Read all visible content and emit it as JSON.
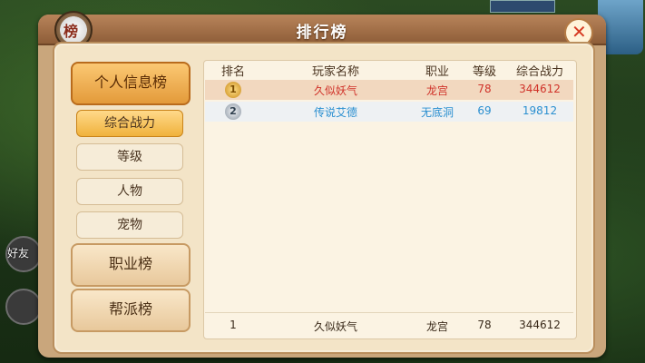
{
  "panel": {
    "title": "排行榜",
    "rank_icon_glyph": "榜",
    "close_glyph": "✕"
  },
  "hud": {
    "friends_label": "好友"
  },
  "nav": {
    "main": [
      {
        "label": "个人信息榜",
        "active": true
      },
      {
        "label": "职业榜",
        "active": false
      },
      {
        "label": "帮派榜",
        "active": false
      }
    ],
    "sub": [
      {
        "label": "综合战力",
        "active": true
      },
      {
        "label": "等级",
        "active": false
      },
      {
        "label": "人物",
        "active": false
      },
      {
        "label": "宠物",
        "active": false
      }
    ]
  },
  "table": {
    "headers": [
      "排名",
      "玩家名称",
      "职业",
      "等级",
      "综合战力"
    ],
    "rows": [
      {
        "rank": "1",
        "name": "久似妖气",
        "job": "龙宫",
        "level": "78",
        "power": "344612",
        "color": "#d0332a"
      },
      {
        "rank": "2",
        "name": "传说艾德",
        "job": "无底洞",
        "level": "69",
        "power": "19812",
        "color": "#2a8fd0"
      }
    ],
    "self_row": {
      "rank": "1",
      "name": "久似妖气",
      "job": "龙宫",
      "level": "78",
      "power": "344612"
    }
  }
}
